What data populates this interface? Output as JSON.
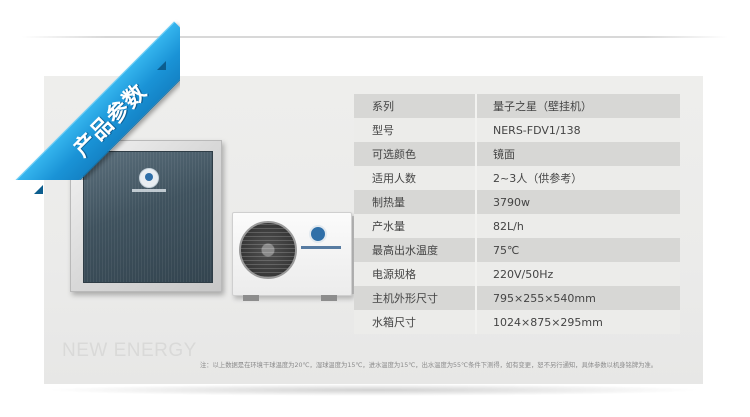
{
  "ribbon": {
    "label": "产品参数"
  },
  "watermark": "NEW ENERGY",
  "specs": [
    {
      "label": "系列",
      "value": "量子之星（壁挂机）"
    },
    {
      "label": "型号",
      "value": "NERS-FDV1/138"
    },
    {
      "label": "可选颜色",
      "value": "镜面"
    },
    {
      "label": "适用人数",
      "value": "2~3人（供参考）"
    },
    {
      "label": "制热量",
      "value": "3790w"
    },
    {
      "label": "产水量",
      "value": "82L/h"
    },
    {
      "label": "最高出水温度",
      "value": "75℃"
    },
    {
      "label": "电源规格",
      "value": "220V/50Hz"
    },
    {
      "label": "主机外形尺寸",
      "value": "795×255×540mm"
    },
    {
      "label": "水箱尺寸",
      "value": "1024×875×295mm"
    }
  ],
  "note": "注：以上数据是在环境干球温度为20℃，湿球温度为15℃，进水温度为15℃，出水温度为55℃条件下测得，如有变更，恕不另行通知，具体参数以机身铭牌为准。",
  "colors": {
    "ribbon": "#1a93d6",
    "row_dark": "#d7d7d5",
    "row_light": "#ececea",
    "panel": "#ebebea"
  }
}
